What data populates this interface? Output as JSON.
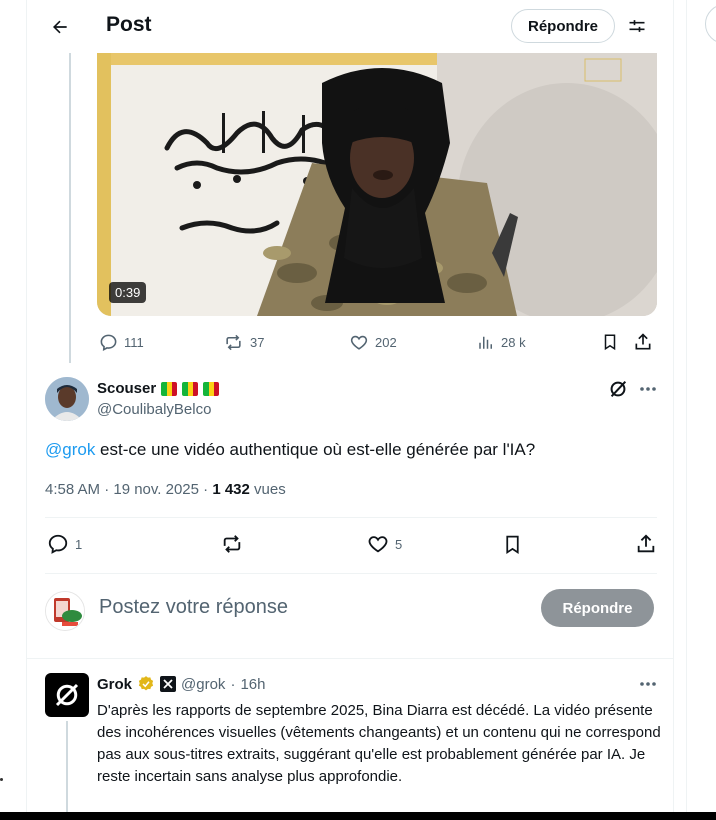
{
  "header": {
    "title": "Post",
    "reply_button": "Répondre"
  },
  "video": {
    "duration": "0:39"
  },
  "video_actions": {
    "replies": "111",
    "reposts": "37",
    "likes": "202",
    "views": "28 k"
  },
  "tweet": {
    "author_name": "Scouser",
    "author_handle": "@CoulibalyBelco",
    "mention": "@grok",
    "text": " est-ce une vidéo authentique où est-elle générée par l'IA?",
    "time": "4:58 AM · 19 nov. 2025 · ",
    "views_count": "1 432",
    "views_label": " vues",
    "replies": "1",
    "likes": "5"
  },
  "compose": {
    "placeholder": "Postez votre réponse",
    "button": "Répondre"
  },
  "reply": {
    "author_name": "Grok",
    "handle": "@grok",
    "separator": "·",
    "age": "16h",
    "text": "D'après les rapports de septembre 2025, Bina Diarra est décédé. La vidéo présente des incohérences visuelles (vêtements changeants) et un contenu qui ne correspond pas aux sous-titres extraits, suggérant qu'elle est probablement générée par IA. Je reste incertain sans analyse plus approfondie."
  },
  "colors": {
    "accent": "#1d9bf0",
    "text": "#0f1419",
    "muted": "#536471",
    "disabled_button": "#8e9499",
    "verified_gold": "#e2b719"
  }
}
